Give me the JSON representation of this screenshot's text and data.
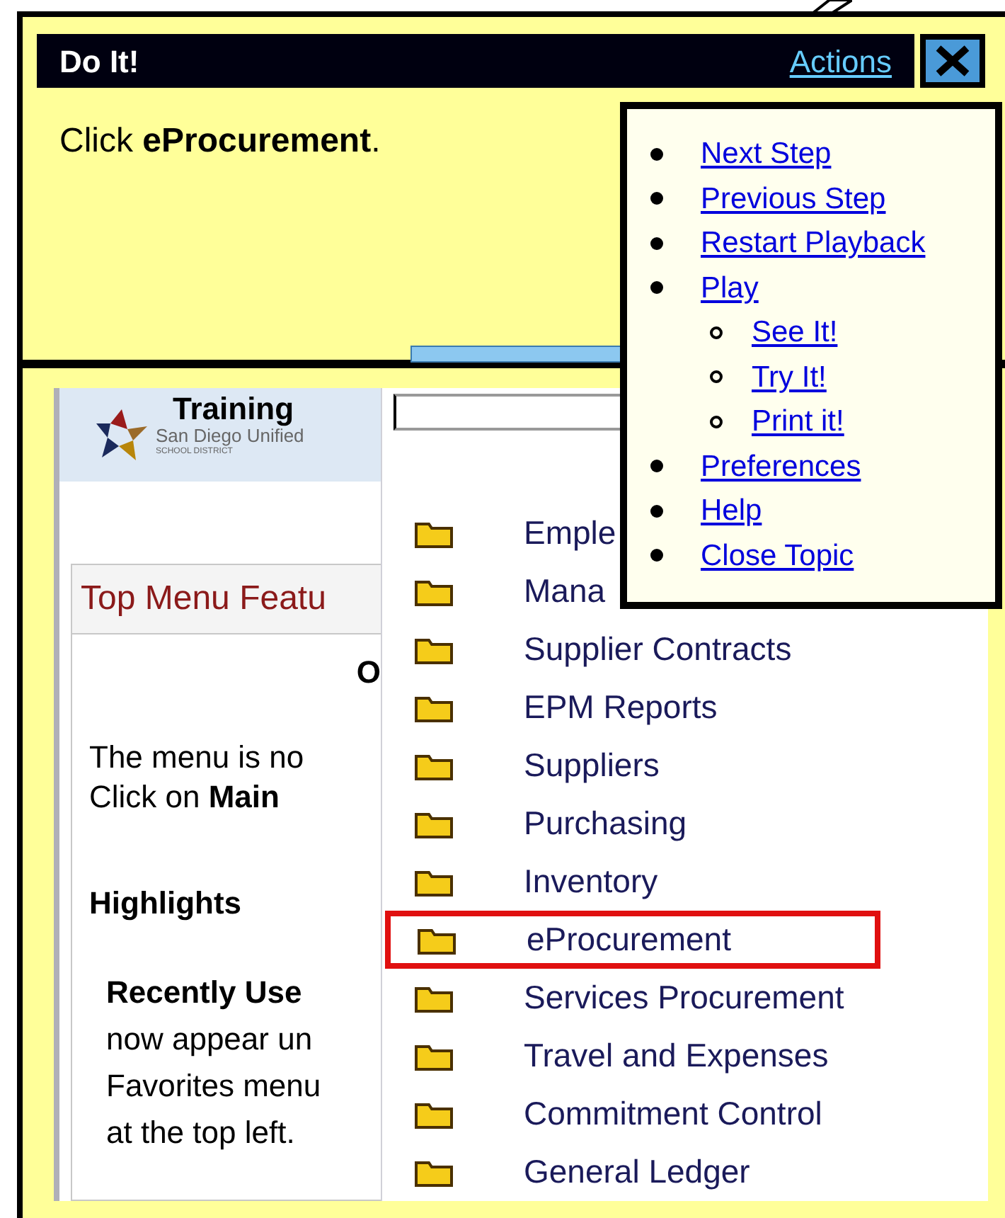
{
  "instruction_panel": {
    "title": "Do It!",
    "actions_link": "Actions",
    "text": "Click **eProcurement**."
  },
  "actions_menu": {
    "items": [
      {
        "label": "Next Step"
      },
      {
        "label": "Previous Step"
      },
      {
        "label": "Restart Playback"
      },
      {
        "label": "Play",
        "children": [
          {
            "label": "See It!"
          },
          {
            "label": "Try It!"
          },
          {
            "label": "Print it!"
          }
        ]
      },
      {
        "label": "Preferences"
      },
      {
        "label": "Help"
      },
      {
        "label": "Close Topic"
      }
    ]
  },
  "page": {
    "logo": {
      "title": "Training",
      "name": "San Diego Unified",
      "subtitle": "SCHOOL DISTRICT"
    },
    "section_title": "Top Menu Featu",
    "heading": "O",
    "paragraph": [
      "The menu is no",
      "Click on **Main**"
    ],
    "highlights_title": "Highlights",
    "recent": [
      "**Recently Use**",
      "now appear un",
      "Favorites menu",
      "at the top left."
    ]
  },
  "menu": {
    "items": [
      {
        "label": "Emple",
        "selected": false
      },
      {
        "label": "Mana",
        "selected": false
      },
      {
        "label": "Supplier Contracts",
        "selected": false
      },
      {
        "label": "EPM Reports",
        "selected": false
      },
      {
        "label": "Suppliers",
        "selected": false
      },
      {
        "label": "Purchasing",
        "selected": false
      },
      {
        "label": "Inventory",
        "selected": false
      },
      {
        "label": "eProcurement",
        "selected": true
      },
      {
        "label": "Services Procurement",
        "selected": false
      },
      {
        "label": "Travel and Expenses",
        "selected": false
      },
      {
        "label": "Commitment Control",
        "selected": false
      },
      {
        "label": "General Ledger",
        "selected": false
      }
    ]
  }
}
